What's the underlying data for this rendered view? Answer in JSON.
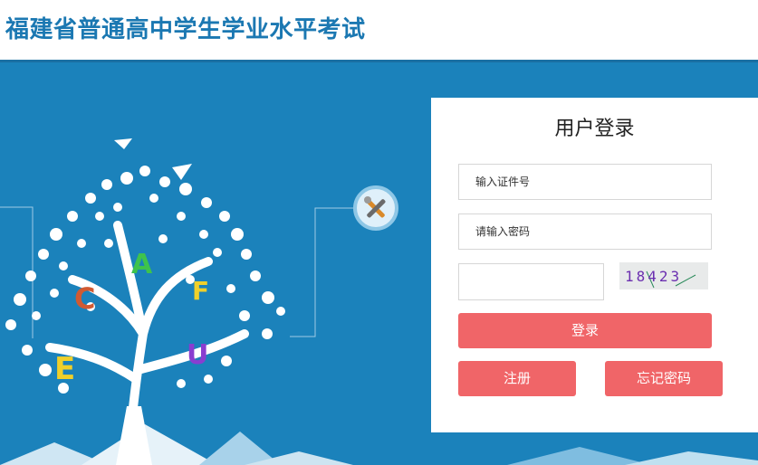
{
  "header": {
    "title": "福建省普通高中学生学业水平考试"
  },
  "login": {
    "title": "用户登录",
    "id_placeholder": "输入证件号",
    "password_placeholder": "请输入密码",
    "captcha_text": "18423",
    "login_label": "登录",
    "register_label": "注册",
    "forgot_label": "忘记密码"
  },
  "decor": {
    "letters": [
      "A",
      "C",
      "F",
      "E",
      "U"
    ],
    "tools_icon": "tools-icon"
  },
  "colors": {
    "banner": "#1b82bb",
    "title": "#1b78b2",
    "button": "#f06568"
  }
}
